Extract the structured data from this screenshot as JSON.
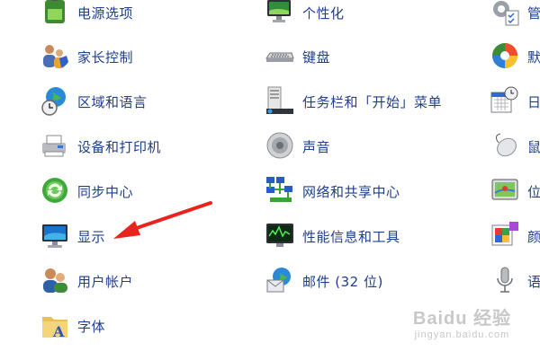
{
  "columns": [
    {
      "items": [
        {
          "label": "电源选项",
          "icon": "battery-icon"
        },
        {
          "label": "家长控制",
          "icon": "parental-controls-icon"
        },
        {
          "label": "区域和语言",
          "icon": "region-globe-icon"
        },
        {
          "label": "设备和打印机",
          "icon": "printer-icon"
        },
        {
          "label": "同步中心",
          "icon": "sync-icon"
        },
        {
          "label": "显示",
          "icon": "monitor-icon"
        },
        {
          "label": "用户帐户",
          "icon": "users-icon"
        },
        {
          "label": "字体",
          "icon": "font-folder-icon"
        }
      ]
    },
    {
      "items": [
        {
          "label": "个性化",
          "icon": "personalization-icon"
        },
        {
          "label": "键盘",
          "icon": "keyboard-icon"
        },
        {
          "label": "任务栏和「开始」菜单",
          "icon": "taskbar-icon"
        },
        {
          "label": "声音",
          "icon": "speaker-icon"
        },
        {
          "label": "网络和共享中心",
          "icon": "network-icon"
        },
        {
          "label": "性能信息和工具",
          "icon": "performance-icon"
        },
        {
          "label": "邮件 (32 位)",
          "icon": "mail-icon"
        }
      ]
    },
    {
      "items": [
        {
          "label": "管",
          "icon": "admin-tools-icon"
        },
        {
          "label": "默",
          "icon": "default-programs-icon"
        },
        {
          "label": "日",
          "icon": "calendar-clock-icon"
        },
        {
          "label": "鼠",
          "icon": "mouse-icon"
        },
        {
          "label": "位",
          "icon": "location-icon"
        },
        {
          "label": "颜",
          "icon": "color-management-icon"
        },
        {
          "label": "语",
          "icon": "microphone-icon"
        }
      ]
    }
  ],
  "annotation": {
    "icon": "red-arrow-icon",
    "color": "#e8241f"
  },
  "watermark": {
    "main": "Baidu 经验",
    "sub": "jingyan.baidu.com"
  },
  "colors": {
    "link": "#1e3e8e",
    "background": "#ffffff"
  }
}
